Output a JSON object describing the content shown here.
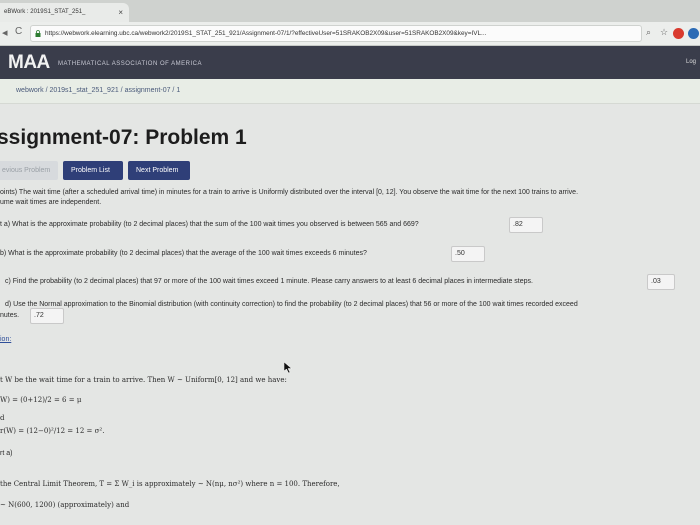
{
  "browser": {
    "tab_title": "eBWork : 2019S1_STAT_251_",
    "tab_close": "×",
    "url": "https://webwork.elearning.ubc.ca/webwork2/2019S1_STAT_251_921/Assignment-07/1/?effectiveUser=51SRAKOB2X09&user=51SRAKOB2X09&key=IVL...",
    "back": "◂",
    "reload": "C"
  },
  "banner": {
    "logo": "MAA",
    "subtitle": "MATHEMATICAL ASSOCIATION OF AMERICA",
    "login": "Log"
  },
  "breadcrumb": "webwork / 2019s1_stat_251_921 / assignment-07 / 1",
  "page_title": "ssignment-07: Problem 1",
  "buttons": {
    "previous": "evious Problem",
    "list": "Problem List",
    "next": "Next Problem"
  },
  "problem": {
    "intro_1": "oints) The wait time (after a scheduled arrival time) in minutes for a train to arrive is Uniformly distributed over the interval [0, 12]. You observe the wait time for the next 100 trains to arrive.",
    "intro_2": "ume wait times are independent.",
    "a_text": "t a) What is the approximate probability (to 2 decimal places) that the sum of the 100 wait times you observed is between 565 and 669?",
    "a_answer": ".82",
    "b_text": "b) What is the approximate probability (to 2 decimal places) that the average of the 100 wait times exceeds 6 minutes?",
    "b_answer": ".50",
    "c_text": "c) Find the probability (to 2 decimal places) that 97 or more of the 100 wait times exceed 1 minute. Please carry answers to at least 6 decimal places in intermediate steps.",
    "c_answer": ".03",
    "d_text_1": "d) Use the Normal approximation to the Binomial distribution (with continuity correction) to find the probability (to 2 decimal places) that 56 or more of the 100 wait times recorded exceed",
    "d_text_2": "nutes.",
    "d_answer": ".72"
  },
  "solution": {
    "link": "ion:",
    "line_1": "t W be the wait time for a train to arrive. Then W ~ Uniform[0, 12] and we have:",
    "line_2": "W) = (0+12)/2 = 6 = μ",
    "line_3": "d",
    "line_4": "r(W) = (12−0)²/12 = 12 = σ².",
    "line_5": "rt a)",
    "line_6": "the Central Limit Theorem, T = Σ W_i is approximately ~ N(nμ, nσ²) where n = 100. Therefore,",
    "line_7": "~ N(600, 1200) (approximately) and"
  },
  "colors": {
    "banner": "#3a3d4b",
    "primary_button": "#2f3f78",
    "page_bg": "#e4e6e4"
  }
}
